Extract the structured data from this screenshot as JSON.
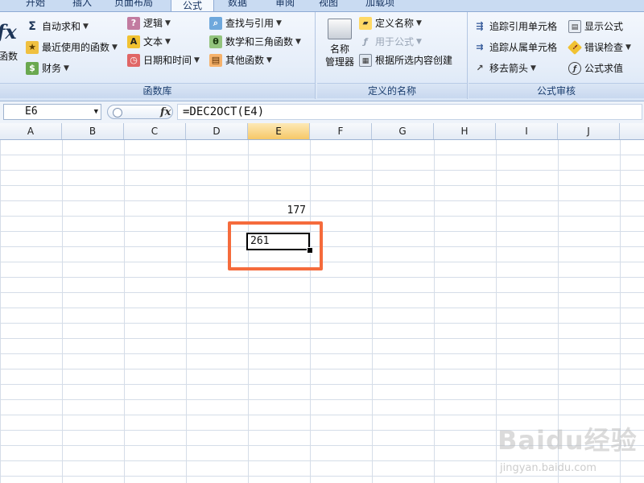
{
  "tabs": [
    "开始",
    "插入",
    "页面布局",
    "公式",
    "数据",
    "审阅",
    "视图",
    "加载项"
  ],
  "active_tab": "公式",
  "ribbon": {
    "function_library": {
      "insert_function_label": "函数",
      "autosum": "自动求和",
      "recent": "最近使用的函数",
      "financial": "财务",
      "logical": "逻辑",
      "text": "文本",
      "datetime": "日期和时间",
      "lookup": "查找与引用",
      "math": "数学和三角函数",
      "other": "其他函数",
      "group_label": "函数库"
    },
    "defined_names": {
      "name_manager_line1": "名称",
      "name_manager_line2": "管理器",
      "define_name": "定义名称",
      "use_in_formula": "用于公式",
      "create_from_selection": "根据所选内容创建",
      "group_label": "定义的名称"
    },
    "formula_auditing": {
      "trace_precedents": "追踪引用单元格",
      "trace_dependents": "追踪从属单元格",
      "remove_arrows": "移去箭头",
      "show_formulas": "显示公式",
      "error_checking": "错误检查",
      "evaluate_formula": "公式求值",
      "group_label": "公式审核"
    }
  },
  "formula_bar": {
    "name_box": "E6",
    "fx_label": "fx",
    "formula": "=DEC2OCT(E4)"
  },
  "columns": [
    "A",
    "B",
    "C",
    "D",
    "E",
    "F",
    "G",
    "H",
    "I",
    "J"
  ],
  "selected_column": "E",
  "cells": {
    "E4": "177",
    "E6": "261"
  },
  "colors": {
    "highlight": "#f56b3c",
    "ribbon_bg": "#e6eef9",
    "selected_header": "#f6c867"
  },
  "watermark": {
    "logo": "Baidu经验",
    "url": "jingyan.baidu.com"
  }
}
